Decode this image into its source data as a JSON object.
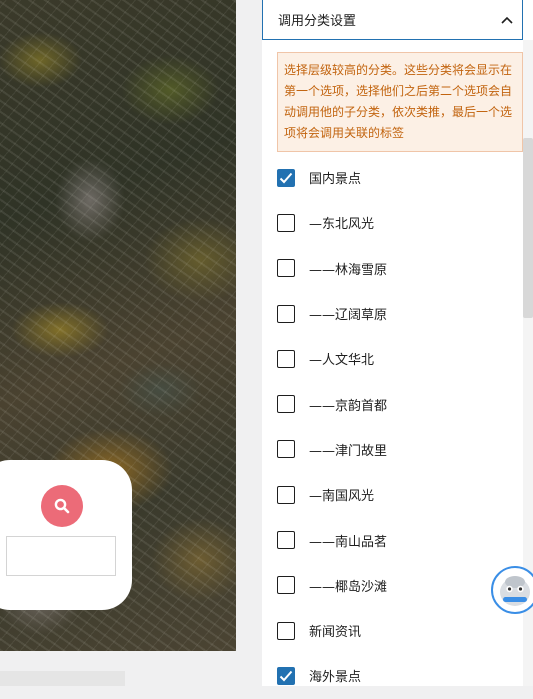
{
  "preview": {
    "search_placeholder": ""
  },
  "panel": {
    "title": "调用分类设置",
    "notice": "选择层级较高的分类。这些分类将会显示在第一个选项，选择他们之后第二个选项会自动调用他的子分类，依次类推，最后一个选项将会调用关联的标签",
    "categories": [
      {
        "label": "国内景点",
        "checked": true
      },
      {
        "label": "—东北风光",
        "checked": false
      },
      {
        "label": "——林海雪原",
        "checked": false
      },
      {
        "label": "——辽阔草原",
        "checked": false
      },
      {
        "label": "—人文华北",
        "checked": false
      },
      {
        "label": "——京韵首都",
        "checked": false
      },
      {
        "label": "——津门故里",
        "checked": false
      },
      {
        "label": "—南国风光",
        "checked": false
      },
      {
        "label": "——南山品茗",
        "checked": false
      },
      {
        "label": "——椰岛沙滩",
        "checked": false
      },
      {
        "label": "新闻资讯",
        "checked": false
      },
      {
        "label": "海外景点",
        "checked": true
      }
    ]
  },
  "colors": {
    "accent": "#2271b1",
    "search_button": "#ec6b78",
    "notice_text": "#c2640f",
    "notice_bg": "#fcf0e5"
  },
  "icons": {
    "search": "search-icon",
    "collapse": "chevron-up-icon",
    "check": "checkmark-icon",
    "mascot": "mascot-avatar-icon"
  }
}
